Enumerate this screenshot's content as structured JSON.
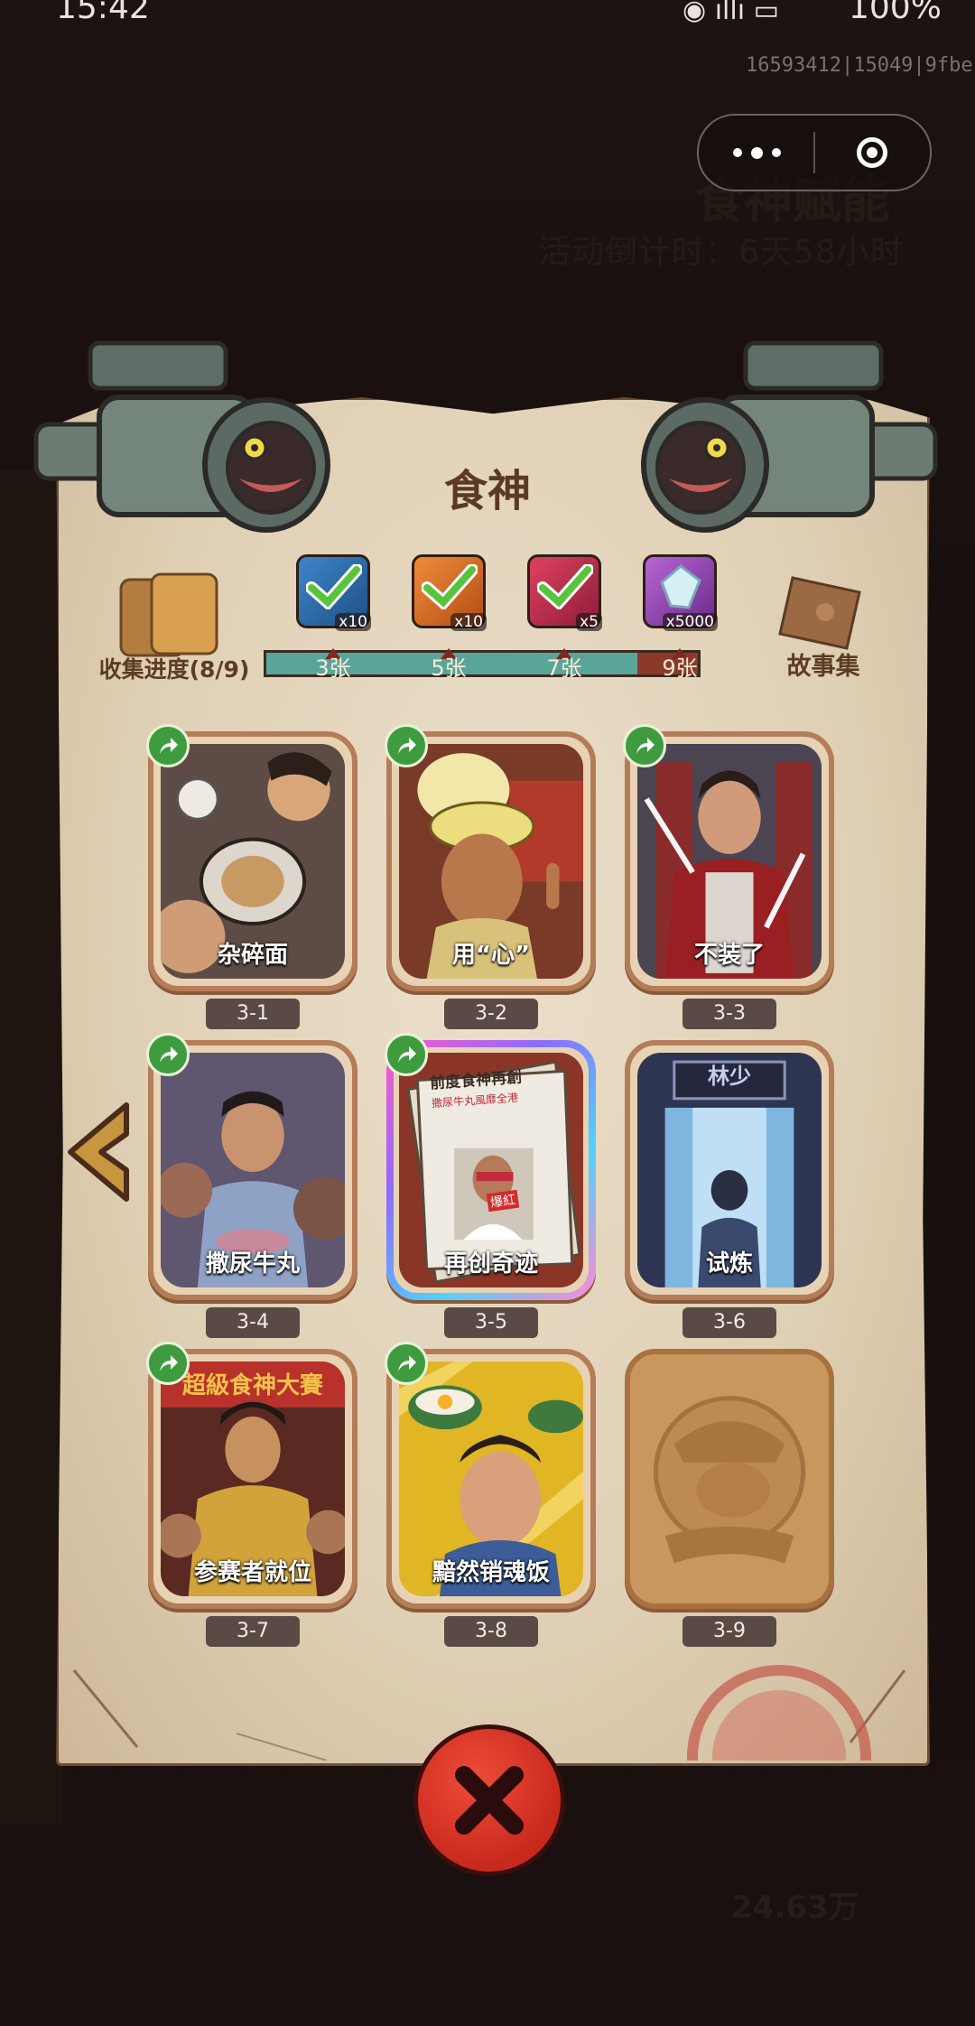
{
  "status_bar": {
    "time": "15:42",
    "battery": "100%"
  },
  "build_id": "16593412|15049|9fbe",
  "background": {
    "title": "食神赋能",
    "countdown": "活动倒计时：6天58小时",
    "amount": "24.63万"
  },
  "panel": {
    "title": "食神"
  },
  "collection": {
    "label": "收集进度(8/9)",
    "progress": 0.86
  },
  "story": {
    "label": "故事集"
  },
  "rewards": [
    {
      "qty": "x10",
      "claimed": true,
      "icon": "treasure-chest-icon"
    },
    {
      "qty": "x10",
      "claimed": true,
      "icon": "gem-bag-icon"
    },
    {
      "qty": "x5",
      "claimed": true,
      "icon": "magic-orb-icon"
    },
    {
      "qty": "x5000",
      "claimed": false,
      "icon": "crystal-icon"
    }
  ],
  "milestones": [
    "3张",
    "5张",
    "7张",
    "9张"
  ],
  "cards": [
    {
      "id": "3-1",
      "title": "杂碎面",
      "shareable": true
    },
    {
      "id": "3-2",
      "title": "用“心”",
      "shareable": true
    },
    {
      "id": "3-3",
      "title": "不装了",
      "shareable": true
    },
    {
      "id": "3-4",
      "title": "撒尿牛丸",
      "shareable": true
    },
    {
      "id": "3-5",
      "title": "再创奇迹",
      "shareable": true,
      "selected": true
    },
    {
      "id": "3-6",
      "title": "试炼",
      "shareable": false,
      "sign": "林少"
    },
    {
      "id": "3-7",
      "title": "参赛者就位",
      "shareable": true,
      "banner": "超級食神大賽"
    },
    {
      "id": "3-8",
      "title": "黯然销魂饭",
      "shareable": true
    },
    {
      "id": "3-9",
      "title": "",
      "shareable": false,
      "locked": true
    }
  ],
  "newspaper": {
    "headline": "前度食神再創",
    "subhead": "撒尿牛丸風靡全港",
    "badge": "爆紅"
  },
  "colors": {
    "accent_green": "#3e9b3e",
    "progress_fill": "#5aa59a",
    "progress_remaining": "#8c3a28",
    "close_red": "#d8311f",
    "parchment": "#e3d4b8"
  }
}
